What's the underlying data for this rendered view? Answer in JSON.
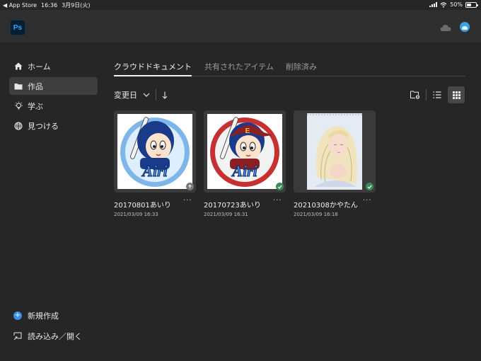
{
  "statusbar": {
    "back_app": "◀ App Store",
    "time": "16:36",
    "date": "3月9日(火)",
    "battery": "50%"
  },
  "app": {
    "logo_text": "Ps"
  },
  "sidebar": {
    "items": [
      {
        "label": "ホーム",
        "icon": "home-icon"
      },
      {
        "label": "作品",
        "icon": "folder-icon",
        "active": true
      },
      {
        "label": "学ぶ",
        "icon": "lightbulb-icon"
      },
      {
        "label": "見つける",
        "icon": "globe-icon"
      }
    ],
    "bottom": [
      {
        "label": "新規作成",
        "icon": "plus-icon"
      },
      {
        "label": "読み込み／開く",
        "icon": "import-icon"
      }
    ]
  },
  "main": {
    "tabs": [
      {
        "label": "クラウドドキュメント",
        "active": true
      },
      {
        "label": "共有されたアイテム"
      },
      {
        "label": "削除済み"
      }
    ],
    "sort": {
      "label": "変更日"
    },
    "files": [
      {
        "name": "20170801あいり",
        "date": "2021/03/09 16:33",
        "sync": "uploading"
      },
      {
        "name": "20170723あいり",
        "date": "2021/03/09 16:31",
        "sync": "synced"
      },
      {
        "name": "20210308かやたん",
        "date": "2021/03/09 16:18",
        "sync": "synced"
      }
    ],
    "more_label": "···"
  },
  "colors": {
    "accent": "#3b8fe8",
    "synced": "#3c8a5a",
    "ps_bg": "#001e36",
    "ps_fg": "#31a8ff"
  }
}
